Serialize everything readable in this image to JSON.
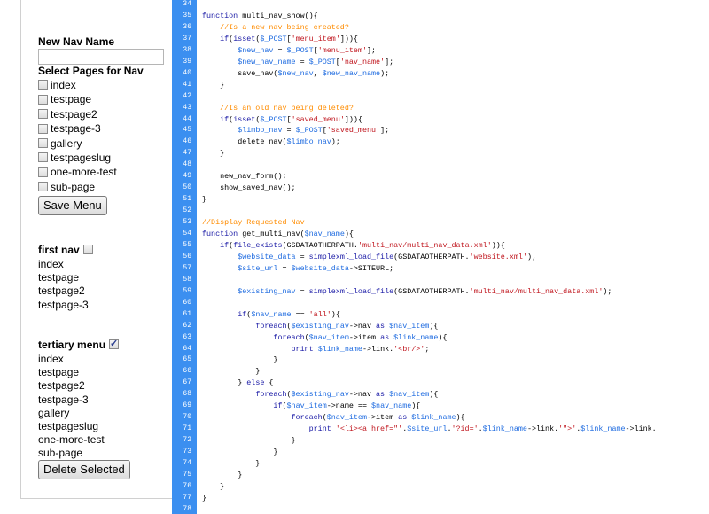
{
  "form": {
    "new_nav_label": "New Nav Name",
    "new_nav_value": "",
    "select_pages_label": "Select Pages for Nav",
    "pages": [
      "index",
      "testpage",
      "testpage2",
      "testpage-3",
      "gallery",
      "testpageslug",
      "one-more-test",
      "sub-page"
    ],
    "save_button": "Save Menu"
  },
  "navs": [
    {
      "title": "first nav",
      "checked": false,
      "items": [
        "index",
        "testpage",
        "testpage2",
        "testpage-3"
      ]
    },
    {
      "title": "tertiary menu",
      "checked": true,
      "items": [
        "index",
        "testpage",
        "testpage2",
        "testpage-3",
        "gallery",
        "testpageslug",
        "one-more-test",
        "sub-page"
      ]
    }
  ],
  "delete_button": "Delete Selected",
  "colors": {
    "gutter": "#3b8ff0",
    "keyword": "#1a1aa6",
    "comment": "#ff8c00",
    "string": "#c0171f",
    "variable": "#1e6be0"
  },
  "code": {
    "lines": [
      {
        "n": "34",
        "t": ""
      },
      {
        "n": "35",
        "t": "function multi_nav_show(){"
      },
      {
        "n": "36",
        "t": "    //Is a new nav being created?"
      },
      {
        "n": "37",
        "t": "    if(isset($_POST['menu_item'])){"
      },
      {
        "n": "38",
        "t": "        $new_nav = $_POST['menu_item'];"
      },
      {
        "n": "39",
        "t": "        $new_nav_name = $_POST['nav_name'];"
      },
      {
        "n": "40",
        "t": "        save_nav($new_nav, $new_nav_name);"
      },
      {
        "n": "41",
        "t": "    }"
      },
      {
        "n": "42",
        "t": ""
      },
      {
        "n": "43",
        "t": "    //Is an old nav being deleted?"
      },
      {
        "n": "44",
        "t": "    if(isset($_POST['saved_menu'])){"
      },
      {
        "n": "45",
        "t": "        $limbo_nav = $_POST['saved_menu'];"
      },
      {
        "n": "46",
        "t": "        delete_nav($limbo_nav);"
      },
      {
        "n": "47",
        "t": "    }"
      },
      {
        "n": "48",
        "t": ""
      },
      {
        "n": "49",
        "t": "    new_nav_form();"
      },
      {
        "n": "50",
        "t": "    show_saved_nav();"
      },
      {
        "n": "51",
        "t": "}"
      },
      {
        "n": "52",
        "t": ""
      },
      {
        "n": "53",
        "t": "//Display Requested Nav"
      },
      {
        "n": "54",
        "t": "function get_multi_nav($nav_name){"
      },
      {
        "n": "55",
        "t": "    if(file_exists(GSDATAOTHERPATH.'multi_nav/multi_nav_data.xml')){"
      },
      {
        "n": "56",
        "t": "        $website_data = simplexml_load_file(GSDATAOTHERPATH.'website.xml');"
      },
      {
        "n": "57",
        "t": "        $site_url = $website_data->SITEURL;"
      },
      {
        "n": "58",
        "t": ""
      },
      {
        "n": "59",
        "t": "        $existing_nav = simplexml_load_file(GSDATAOTHERPATH.'multi_nav/multi_nav_data.xml');"
      },
      {
        "n": "60",
        "t": ""
      },
      {
        "n": "61",
        "t": "        if($nav_name == 'all'){"
      },
      {
        "n": "62",
        "t": "            foreach($existing_nav->nav as $nav_item){"
      },
      {
        "n": "63",
        "t": "                foreach($nav_item->item as $link_name){"
      },
      {
        "n": "64",
        "t": "                    print $link_name->link.'<br/>';"
      },
      {
        "n": "65",
        "t": "                }"
      },
      {
        "n": "66",
        "t": "            }"
      },
      {
        "n": "67",
        "t": "        } else {"
      },
      {
        "n": "68",
        "t": "            foreach($existing_nav->nav as $nav_item){"
      },
      {
        "n": "69",
        "t": "                if($nav_item->name == $nav_name){"
      },
      {
        "n": "70",
        "t": "                    foreach($nav_item->item as $link_name){"
      },
      {
        "n": "71",
        "t": "                        print '<li><a href=\"'.$site_url.'?id='.$link_name->link.'\">'.$link_name->link."
      },
      {
        "n": "72",
        "t": "                    }"
      },
      {
        "n": "73",
        "t": "                }"
      },
      {
        "n": "74",
        "t": "            }"
      },
      {
        "n": "75",
        "t": "        }"
      },
      {
        "n": "76",
        "t": "    }"
      },
      {
        "n": "77",
        "t": "}"
      },
      {
        "n": "78",
        "t": ""
      }
    ]
  }
}
